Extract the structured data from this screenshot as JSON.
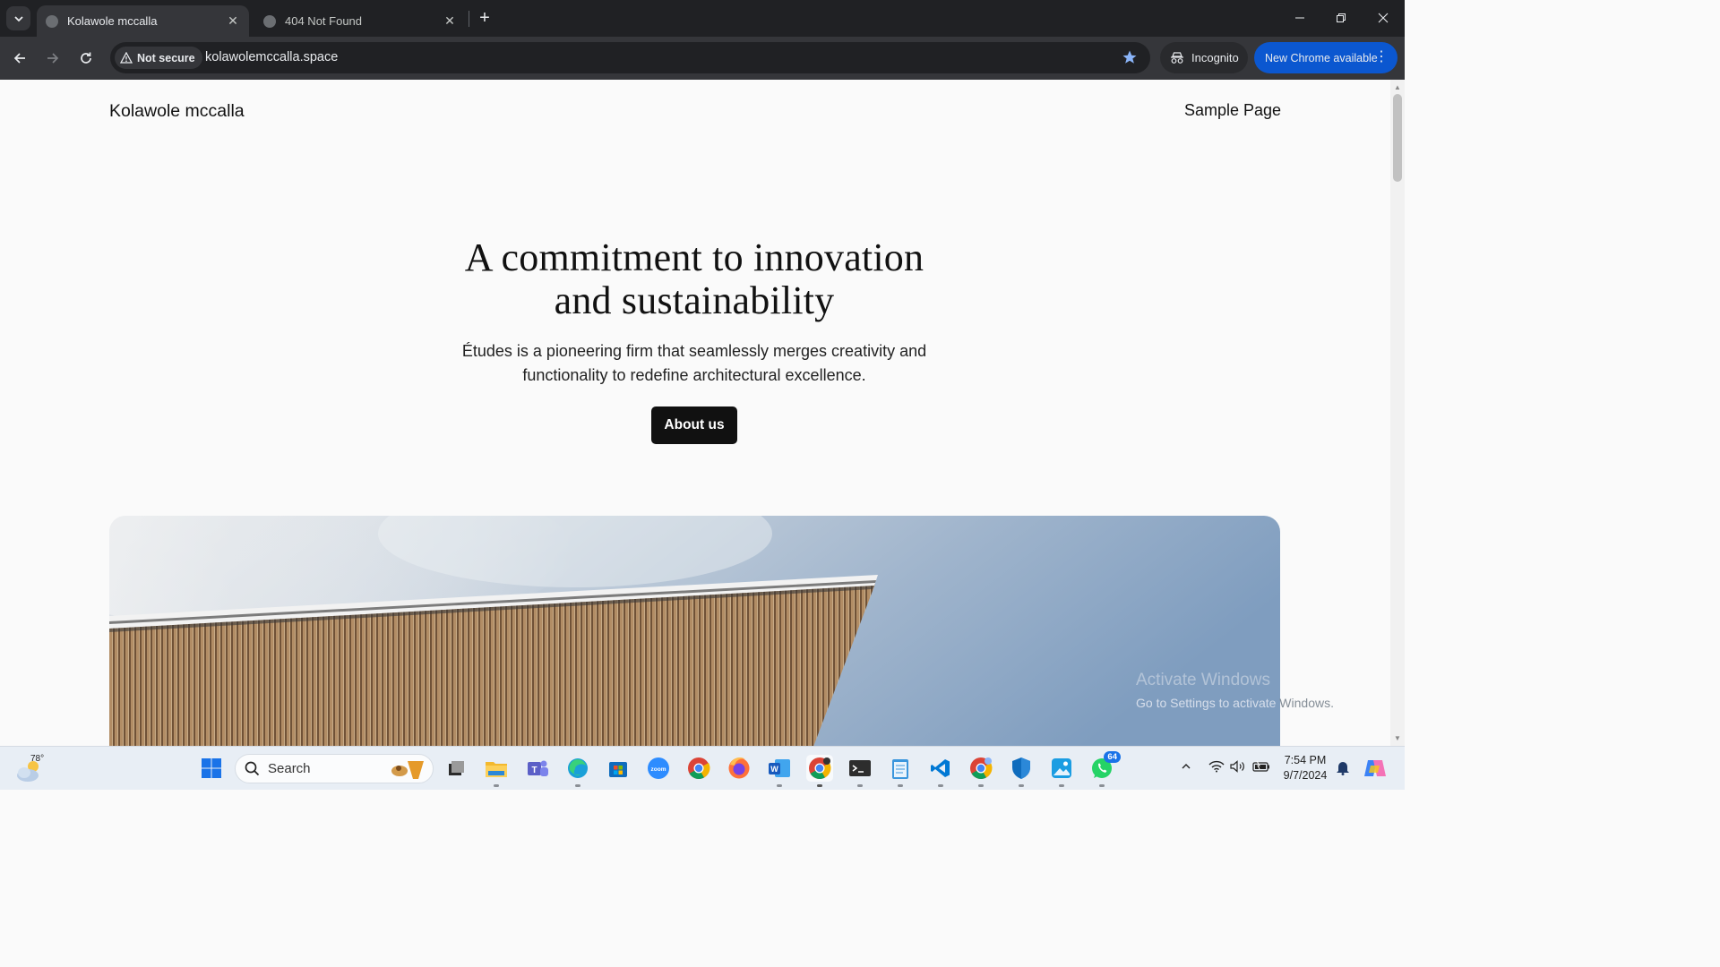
{
  "browser": {
    "tabs": [
      {
        "title": "Kolawole mccalla",
        "active": true
      },
      {
        "title": "404 Not Found",
        "active": false
      }
    ],
    "security_label": "Not secure",
    "url": "kolawolemccalla.space",
    "incognito_label": "Incognito",
    "update_label": "New Chrome available"
  },
  "page": {
    "site_title": "Kolawole mccalla",
    "nav_link": "Sample Page",
    "hero_line1": "A commitment to innovation",
    "hero_line2": "and sustainability",
    "hero_sub_line1": "Études is a pioneering firm that seamlessly merges creativity and",
    "hero_sub_line2": "functionality to redefine architectural excellence.",
    "cta_label": "About us",
    "watermark_title": "Activate Windows",
    "watermark_sub_prefix": "Go to Settings to activate",
    "watermark_sub_suffix": " Windows."
  },
  "taskbar": {
    "weather_temp": "78°",
    "search_placeholder": "Search",
    "time": "7:54 PM",
    "date": "9/7/2024",
    "whatsapp_badge": "64",
    "icons": [
      "windows-start-icon",
      "task-view-icon",
      "file-explorer-icon",
      "teams-icon",
      "edge-icon",
      "store-icon",
      "zoom-icon",
      "chrome-icon",
      "firefox-icon",
      "word-icon",
      "chrome-dev-icon",
      "terminal-icon",
      "notepad-icon",
      "vscode-icon",
      "chrome-profile-icon",
      "defender-icon",
      "photos-icon",
      "whatsapp-icon"
    ]
  },
  "colors": {
    "tabstrip": "#202124",
    "toolbar": "#35363a",
    "update_button": "#0b57d0",
    "cta_background": "#111111",
    "page_background": "#fafafa"
  }
}
